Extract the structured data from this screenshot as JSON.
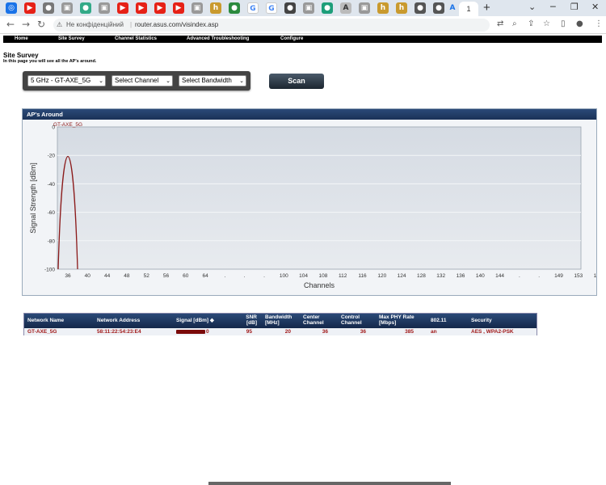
{
  "browser": {
    "active_tab_label": "1",
    "new_tab_label": "+",
    "insecure_label": "Не конфіденційний",
    "url": "router.asus.com/visindex.asp"
  },
  "menu": {
    "items": [
      "Home",
      "Site Survey",
      "Channel Statistics",
      "Advanced Troubleshooting",
      "Configure"
    ]
  },
  "page": {
    "title": "Site Survey",
    "subtitle": "In this page you will see all the AP's around."
  },
  "controls": {
    "network_select": "5 GHz - GT-AXE_5G",
    "channel_select": "Select Channel",
    "bandwidth_select": "Select Bandwidth",
    "scan_label": "Scan"
  },
  "chart_panel": {
    "title": "AP's Around"
  },
  "chart_data": {
    "type": "area",
    "ylabel": "Signal Strength [dBm]",
    "xlabel": "Channels",
    "ylim": [
      -100,
      0
    ],
    "yticks": [
      "0",
      "-20",
      "-40",
      "-60",
      "-80",
      "-100"
    ],
    "xticks": [
      "36",
      "40",
      "44",
      "48",
      "52",
      "56",
      "60",
      "64",
      ".",
      ".",
      ".",
      "100",
      "104",
      "108",
      "112",
      "116",
      "120",
      "124",
      "128",
      "132",
      "136",
      "140",
      "144",
      ".",
      ".",
      "149",
      "153",
      "157",
      "161",
      "165"
    ],
    "grid": true,
    "series": [
      {
        "name": "GT-AXE_5G",
        "center_channel": 36,
        "peak_dbm": 0,
        "color": "#8b1a1a"
      }
    ]
  },
  "table": {
    "headers": [
      "Network Name",
      "Network Address",
      "Signal [dBm] ◆",
      "SNR [dB]",
      "Bandwidth [MHz]",
      "Center Channel",
      "Control Channel",
      "Max PHY Rate [Mbps]",
      "802.11",
      "Security"
    ],
    "rows": [
      [
        "GT-AXE_5G",
        "58:11:22:54:23:E4",
        "0",
        "95",
        "20",
        "36",
        "36",
        "385",
        "an",
        "AES , WPA2-PSK"
      ]
    ]
  }
}
